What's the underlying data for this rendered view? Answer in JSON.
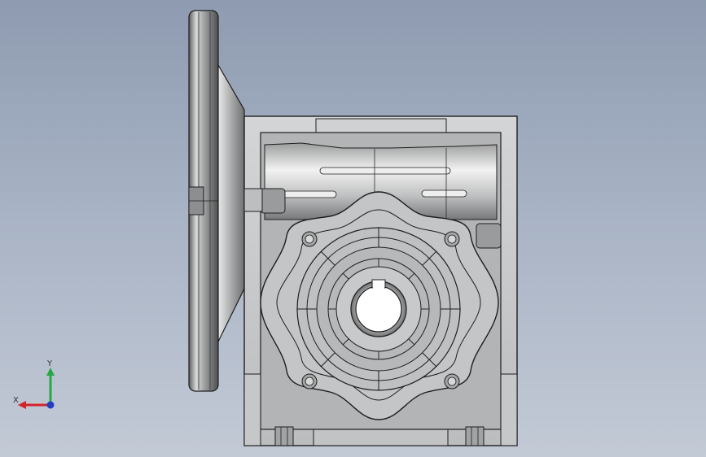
{
  "viewport": {
    "background_top": "#8e9bb0",
    "background_bottom": "#c3cad6"
  },
  "model": {
    "name": "worm-gear-reducer",
    "body_color": "#c9cacb",
    "shadow_color": "#6e6f70",
    "edge_color": "#1e1e1e"
  },
  "triad": {
    "x_label": "X",
    "y_label": "Y",
    "x_color": "#d2232a",
    "y_color": "#28a745",
    "z_color": "#1f3fbf"
  }
}
